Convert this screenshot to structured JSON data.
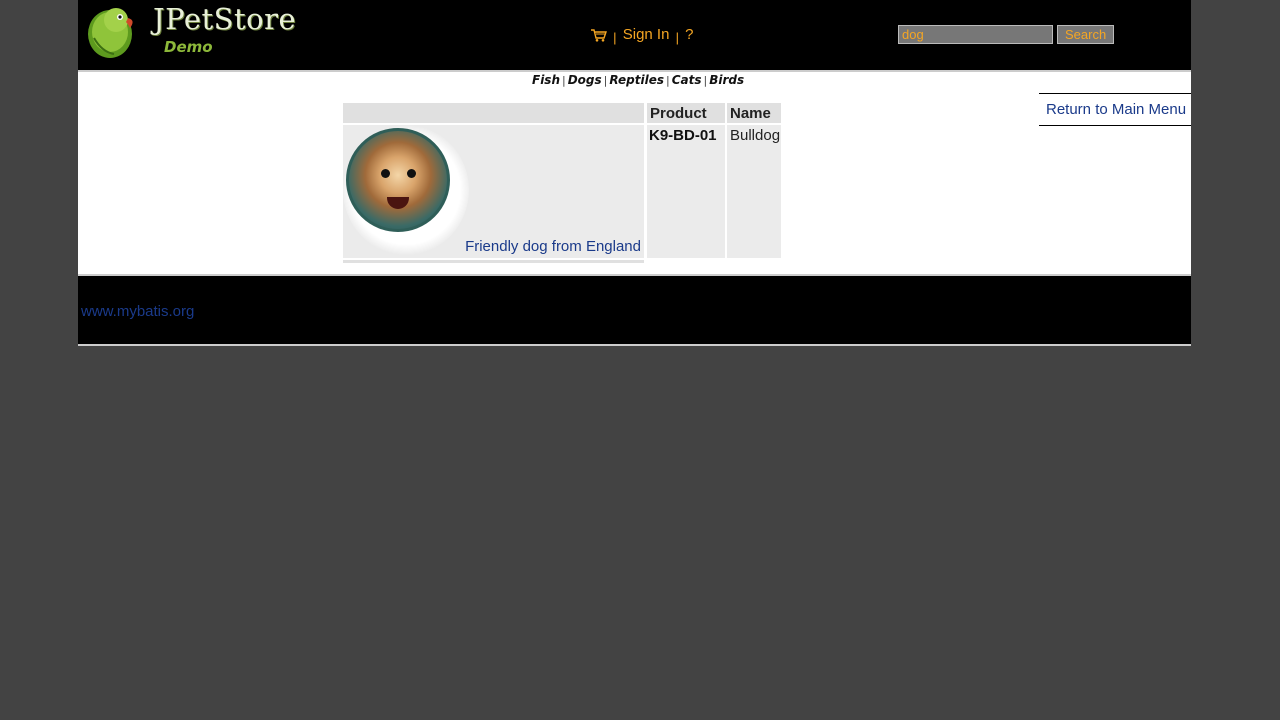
{
  "header": {
    "logo_title": "JPetStore",
    "logo_subtitle": "Demo",
    "cart_icon": "shopping-cart-icon",
    "sign_in_label": "Sign In",
    "help_label": "?",
    "separator": "|",
    "search": {
      "value": "dog",
      "button_label": "Search"
    }
  },
  "quicklinks": {
    "items": [
      "Fish",
      "Dogs",
      "Reptiles",
      "Cats",
      "Birds"
    ],
    "separator": "|"
  },
  "back_link": "Return to Main Menu",
  "catalog": {
    "headers": [
      "Product ID",
      "Name"
    ],
    "rows": [
      {
        "image_icon": "dog-photo",
        "description": "Friendly dog from England",
        "product_id": "K9-BD-01",
        "name": "Bulldog"
      }
    ]
  },
  "footer": {
    "link": "www.mybatis.org"
  },
  "colors": {
    "background": "#434343",
    "header": "#000000",
    "accent": "#f5a623",
    "link": "#1a3a8a"
  }
}
